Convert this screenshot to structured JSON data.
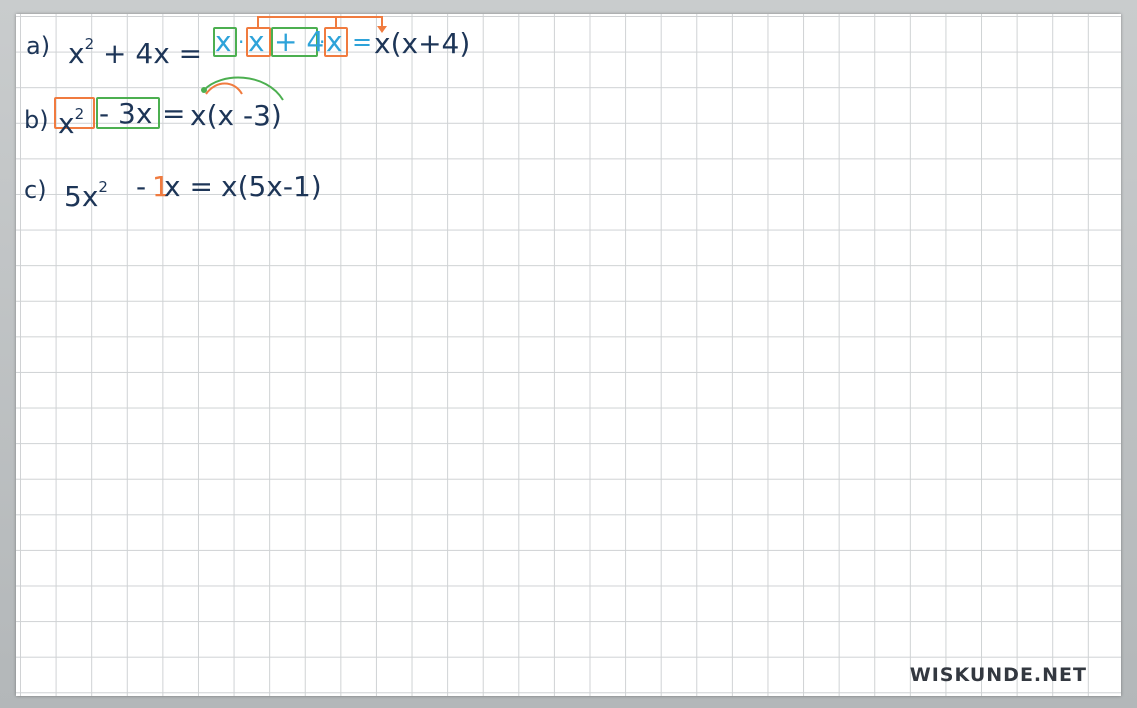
{
  "rows": {
    "a": {
      "label": "a)",
      "lhs_x": "x",
      "lhs_exp": "2",
      "lhs_rest": "+ 4x =",
      "f1": "x",
      "dot1": "·",
      "f2": "x",
      "f3": "+ 4",
      "dot2": "·",
      "f4": "x",
      "eq": "=",
      "result": "x(x+4)"
    },
    "b": {
      "label": "b)",
      "term1_base": "x",
      "term1_exp": "2",
      "term2": "- 3x",
      "eq": "=",
      "result": "x(x -3)"
    },
    "c": {
      "label": "c)",
      "lhs_start": "5x",
      "lhs_exp": "2",
      "minus": "-",
      "one": "1",
      "lhs_end": "x =",
      "result": "x(5x-1)"
    }
  },
  "brand": "WISKUNDE.NET",
  "colors": {
    "ink": "#1d3557",
    "blue": "#2ea3d9",
    "green": "#4caf50",
    "orange": "#f07b3f"
  }
}
